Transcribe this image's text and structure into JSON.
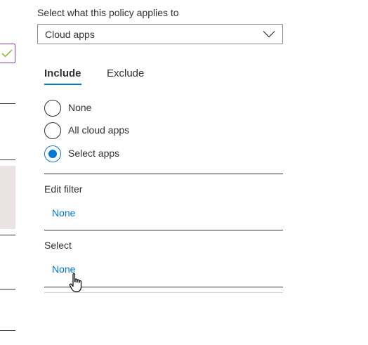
{
  "policy": {
    "applies_label": "Select what this policy applies to",
    "applies_value": "Cloud apps"
  },
  "tabs": [
    {
      "label": "Include",
      "active": true
    },
    {
      "label": "Exclude",
      "active": false
    }
  ],
  "radio_options": [
    {
      "label": "None",
      "checked": false
    },
    {
      "label": "All cloud apps",
      "checked": false
    },
    {
      "label": "Select apps",
      "checked": true
    }
  ],
  "edit_filter": {
    "title": "Edit filter",
    "value": "None"
  },
  "select": {
    "title": "Select",
    "value": "None"
  },
  "colors": {
    "accent": "#0078d4",
    "check_border": "#8a3ab9",
    "check_mark": "#6bb700"
  },
  "icons": {
    "dropdown": "chevron-down-icon",
    "left_check": "checkmark-icon",
    "cursor": "hand-pointer-icon"
  }
}
